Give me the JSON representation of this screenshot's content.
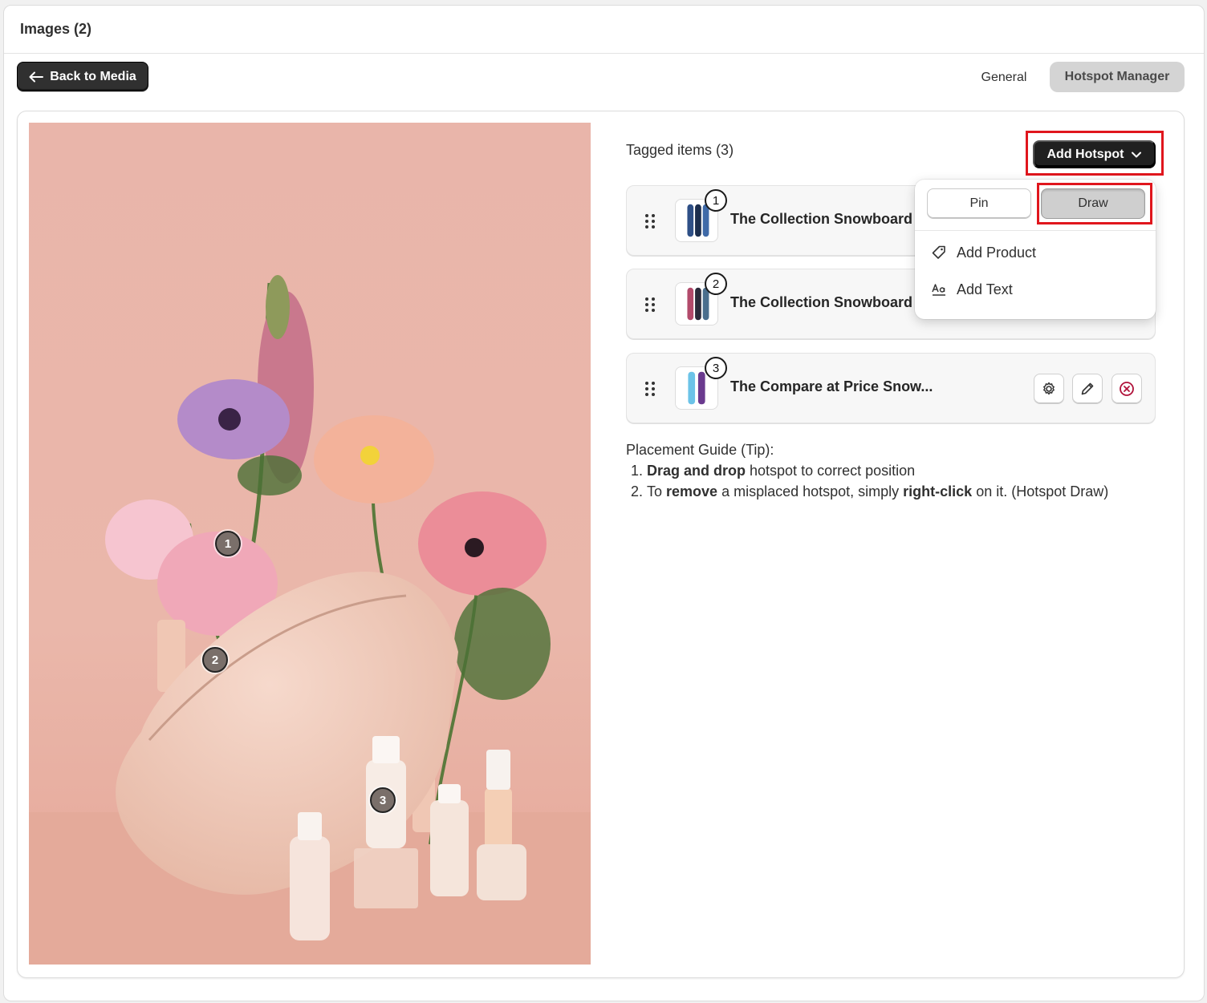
{
  "header": {
    "title": "Images (2)"
  },
  "toolbar": {
    "back_label": "Back to Media",
    "tabs": [
      {
        "label": "General",
        "selected": false
      },
      {
        "label": "Hotspot Manager",
        "selected": true
      }
    ]
  },
  "image": {
    "description": "Pink flowers, cosmetics bag and skincare bottles on pink background",
    "hotspots": [
      {
        "number": "1"
      },
      {
        "number": "2"
      },
      {
        "number": "3"
      }
    ]
  },
  "panel": {
    "tagged_title": "Tagged items (3)",
    "add_hotspot_label": "Add Hotspot",
    "items": [
      {
        "number": "1",
        "name": "The Collection Snowboard"
      },
      {
        "number": "2",
        "name": "The Collection Snowboard"
      },
      {
        "number": "3",
        "name": "The Compare at Price Snow..."
      }
    ],
    "guide": {
      "title": "Placement Guide (Tip):",
      "step1_bold": "Drag and drop",
      "step1_rest": " hotspot to correct position",
      "step2_pre": "To ",
      "step2_bold1": "remove",
      "step2_mid": " a misplaced hotspot, simply ",
      "step2_bold2": "right-click",
      "step2_post": " on it. (Hotspot Draw)"
    }
  },
  "dropdown": {
    "pin_label": "Pin",
    "draw_label": "Draw",
    "add_product_label": "Add Product",
    "add_text_label": "Add Text"
  },
  "colors": {
    "primary_button": "#303030",
    "highlight": "#e0161d",
    "photo_bg": "#e8b3a6",
    "delete_icon": "#b0123a"
  }
}
